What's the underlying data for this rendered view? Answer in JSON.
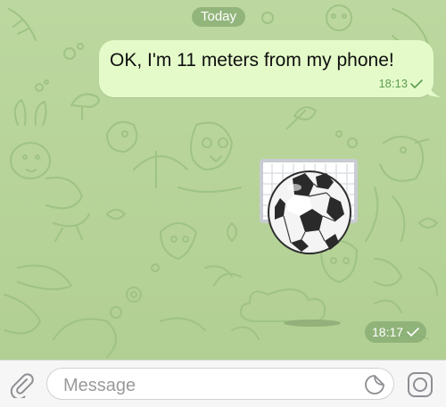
{
  "chat": {
    "date_separator": "Today",
    "messages": [
      {
        "direction": "outgoing",
        "text": "OK, I'm 11 meters from my phone!",
        "time": "18:13",
        "status": "sent"
      },
      {
        "direction": "outgoing",
        "type": "sticker",
        "sticker": "soccer-ball-goal",
        "time": "18:17",
        "status": "sent"
      }
    ]
  },
  "input": {
    "placeholder": "Message"
  },
  "icons": {
    "attach": "paperclip-icon",
    "sticker": "sticker-icon",
    "camera": "camera-icon",
    "check": "check-icon"
  },
  "colors": {
    "chat_background": "#b9d49c",
    "outgoing_bubble": "#e4fbc9",
    "timestamp_green": "#5e9d52",
    "icon_gray": "#8e8e93"
  }
}
